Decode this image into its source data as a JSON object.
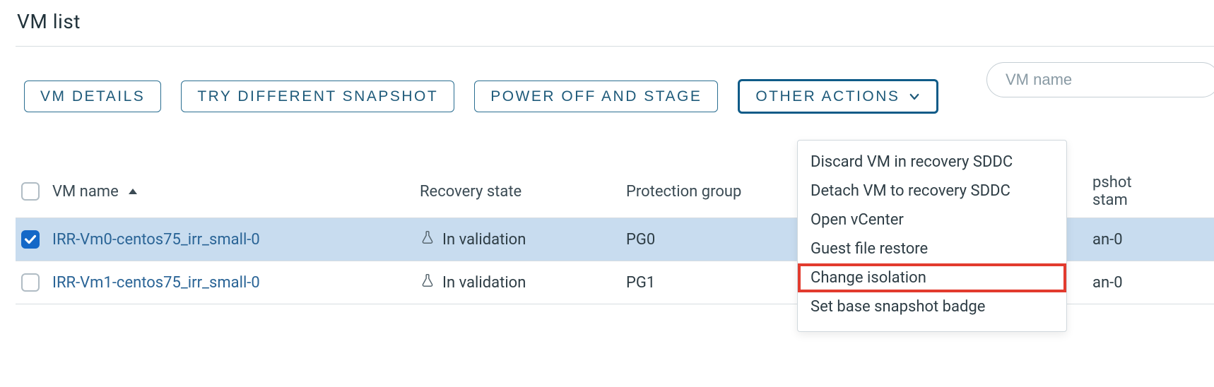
{
  "header": {
    "title": "VM list"
  },
  "toolbar": {
    "vm_details": "VM DETAILS",
    "try_snapshot": "TRY DIFFERENT SNAPSHOT",
    "power_off_stage": "POWER OFF AND STAGE",
    "other_actions": "OTHER ACTIONS"
  },
  "search": {
    "placeholder": "VM name"
  },
  "columns": {
    "name": "VM name",
    "state": "Recovery state",
    "pg": "Protection group",
    "snapshot_lines": [
      "pshot",
      "stam"
    ]
  },
  "rows": [
    {
      "checked": true,
      "name": "IRR-Vm0-centos75_irr_small-0",
      "state": "In validation",
      "pg": "PG0",
      "snap_fragment": "an-0"
    },
    {
      "checked": false,
      "name": "IRR-Vm1-centos75_irr_small-0",
      "state": "In validation",
      "pg": "PG1",
      "snap_fragment": "an-0"
    }
  ],
  "menu": {
    "items": [
      "Discard VM in recovery SDDC",
      "Detach VM to recovery SDDC",
      "Open vCenter",
      "Guest file restore",
      "Change isolation",
      "Set base snapshot badge"
    ],
    "highlight_index": 4
  },
  "icons": {
    "flask": "flask-icon",
    "chevron_down": "chevron-down-icon",
    "checkmark": "checkmark-icon",
    "sort_asc": "sort-asc-icon"
  }
}
